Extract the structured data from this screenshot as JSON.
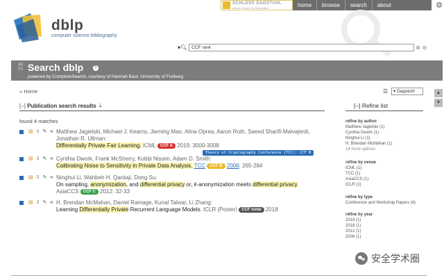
{
  "nav": {
    "items": [
      "home",
      "browse",
      "search",
      "about"
    ],
    "dagstuhl_title": "SCHLOSS DAGSTUHL",
    "dagstuhl_sub": "Leibniz Center for Informatics"
  },
  "brand": {
    "name": "dblp",
    "tagline": "computer science bibliography"
  },
  "search": {
    "value": "CCF rank"
  },
  "header": {
    "toggle": "[+]\n[–]",
    "title": "Search dblp",
    "powered_by": "powered by CompleteSearch, courtesy of Hannah Bast, University of Freiburg"
  },
  "breadcrumb": "» Home",
  "server_select": "▾ Dagstuhl",
  "results": {
    "heading_toggle": "[–]",
    "heading": "Publication search results",
    "found": "found 4 matches",
    "tooltip": "Theory of Cryptography Conference (TCC): CCF B"
  },
  "entries": [
    {
      "authors": "Matthew Jagielski, Michael J. Kearns, Jieming Mao, Alina Oprea, Aaron Roth, Saeed Sharifi-Malvajerdi, Jonathan R. Ullman:",
      "title": "Differentially Private Fair Learning.",
      "venue": "ICML",
      "badge": "CCF A",
      "badge_color": "#d9312b",
      "year_pages": "2019: 3000-3008"
    },
    {
      "authors": "Cynthia Dwork, Frank McSherry, Kobbi Nissim, Adam D. Smith:",
      "title": "Calibrating Noise to Sensitivity in Private Data Analysis.",
      "venue": "TCC",
      "badge": "CCF B",
      "badge_color": "#e9b92e",
      "year": "2006",
      "pages": ": 265-284"
    },
    {
      "authors": "Ninghui Li, Wahbeh H. Qardaji, Dong Su:",
      "title_parts": [
        "On sampling, ",
        "anonymization",
        ", and ",
        "differential privacy",
        " or, ",
        "k",
        "-anonymization meets ",
        "differential privacy",
        "."
      ],
      "venue": "AsiaCCS",
      "badge": "CCF C",
      "badge_color": "#3aa04a",
      "year_pages": "2012: 32-33"
    },
    {
      "authors": "H. Brendan McMahan, Daniel Ramage, Kunal Talwar, Li Zhang:",
      "title_parts": [
        "Learning ",
        "Differentially Private",
        " Recurrent Language Models",
        "."
      ],
      "venue": "ICLR (Poster)",
      "badge": "CCF none",
      "badge_color": "#555555",
      "year_pages": "2018"
    }
  ],
  "refine": {
    "toggle": "[–]",
    "heading": "Refine list",
    "author": {
      "label": "refine by author",
      "items": [
        "Matthew Jagielski (1)",
        "Cynthia Dwork (1)",
        "Ninghui Li (1)",
        "H. Brendan McMahan (1)"
      ],
      "more": "14 more options"
    },
    "venue": {
      "label": "refine by venue",
      "items": [
        "ICML (1)",
        "TCC (1)",
        "AsiaCCS (1)",
        "ICLR (1)"
      ]
    },
    "type": {
      "label": "refine by type",
      "items": [
        "Conference and Workshop Papers (4)"
      ]
    },
    "year": {
      "label": "refine by year",
      "items": [
        "2019 (1)",
        "2018 (1)",
        "2012 (1)",
        "2006 (1)"
      ]
    }
  },
  "watermark": "安全学术圈",
  "colors": {
    "banner": "#7c7c7c",
    "link": "#2a6cb6",
    "highlight": "#fbf5b0",
    "nav": "#6d6d6d"
  },
  "icons": [
    "gear-icon",
    "search-icon",
    "clear-icon",
    "help-icon",
    "database-icon",
    "download-icon",
    "pdf-icon",
    "bibtex-icon",
    "export-icon",
    "share-icon",
    "wechat-icon"
  ]
}
